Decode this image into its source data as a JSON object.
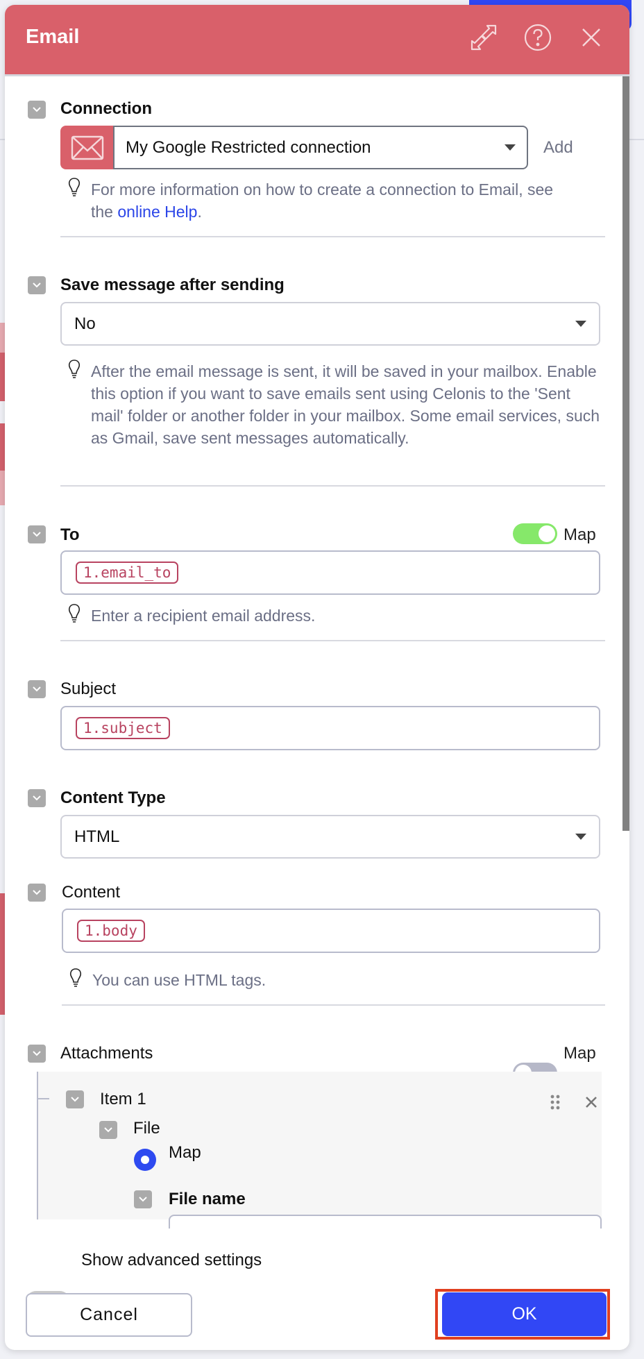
{
  "modal": {
    "title": "Email",
    "header_color": "#d9606a",
    "icons": [
      "expand-icon",
      "help-icon",
      "close-icon"
    ]
  },
  "connection": {
    "label": "Connection",
    "selected": "My Google Restricted connection",
    "add_label": "Add",
    "hint_prefix": "For more information on how to create a connection to Email, see the ",
    "hint_link": "online Help",
    "hint_suffix": "."
  },
  "save_message": {
    "label": "Save message after sending",
    "selected": "No",
    "hint": "After the email message is sent, it will be saved in your mailbox. Enable this option if you want to save emails sent using Celonis to the 'Sent mail' folder or another folder in your mailbox. Some email services, such as Gmail, save sent messages automatically."
  },
  "to": {
    "label": "To",
    "map_label": "Map",
    "map_enabled": true,
    "value": "1.email_to",
    "hint": "Enter a recipient email address."
  },
  "subject": {
    "label": "Subject",
    "value": "1.subject"
  },
  "content_type": {
    "label": "Content Type",
    "selected": "HTML"
  },
  "content": {
    "label": "Content",
    "value": "1.body",
    "hint": "You can use HTML tags."
  },
  "attachments": {
    "label": "Attachments",
    "map_label": "Map",
    "map_enabled": false,
    "items": [
      {
        "label": "Item 1",
        "file_label": "File",
        "radio_label": "Map",
        "radio_selected": true,
        "file_name_label": "File name"
      }
    ]
  },
  "footer": {
    "advanced_label": "Show advanced settings",
    "advanced_enabled": false,
    "cancel_label": "Cancel",
    "ok_label": "OK"
  },
  "colors": {
    "accent": "#3147f5",
    "toggle_on": "#86e86a",
    "toggle_off": "#b6b8c8",
    "pill": "#b84360",
    "highlight_outline": "#e04020"
  }
}
